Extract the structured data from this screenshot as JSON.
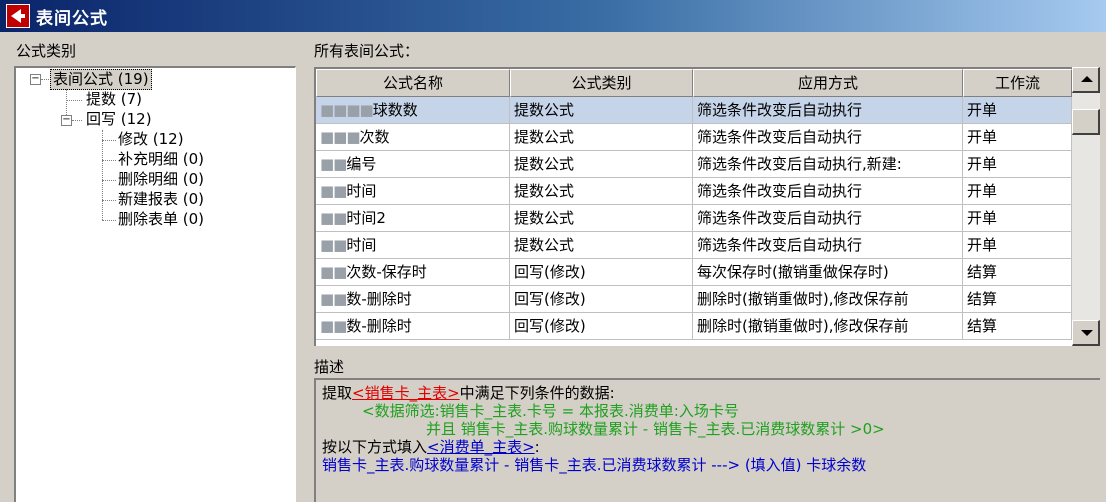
{
  "window": {
    "title": "表间公式"
  },
  "category_panel": {
    "label": "公式类别",
    "tree": {
      "root": "表间公式 (19)",
      "fetch": "提数 (7)",
      "writeback": "回写 (12)",
      "writeback_children": [
        "修改 (12)",
        "补充明细 (0)",
        "删除明细 (0)",
        "新建报表 (0)",
        "删除表单 (0)"
      ]
    }
  },
  "formula_list": {
    "label": "所有表间公式：",
    "columns": [
      "公式名称",
      "公式类别",
      "应用方式",
      "工作流"
    ],
    "rows": [
      {
        "name_hidden": "■■■■",
        "name": "球数数",
        "category": "提数公式",
        "application": "筛选条件改变后自动执行",
        "workflow": "开单"
      },
      {
        "name_hidden": "■■■",
        "name": "次数",
        "category": "提数公式",
        "application": "筛选条件改变后自动执行",
        "workflow": "开单"
      },
      {
        "name_hidden": "■■",
        "name": "编号",
        "category": "提数公式",
        "application": "筛选条件改变后自动执行,新建:",
        "workflow": "开单"
      },
      {
        "name_hidden": "■■",
        "name": "时间",
        "category": "提数公式",
        "application": "筛选条件改变后自动执行",
        "workflow": "开单"
      },
      {
        "name_hidden": "■■",
        "name": "时间2",
        "category": "提数公式",
        "application": "筛选条件改变后自动执行",
        "workflow": "开单"
      },
      {
        "name_hidden": "■■",
        "name": "时间",
        "category": "提数公式",
        "application": "筛选条件改变后自动执行",
        "workflow": "开单"
      },
      {
        "name_hidden": "■■",
        "name": "次数-保存时",
        "category": "回写(修改)",
        "application": "每次保存时(撤销重做保存时)",
        "workflow": "结算"
      },
      {
        "name_hidden": "■■",
        "name": "数-删除时",
        "category": "回写(修改)",
        "application": "删除时(撤销重做时),修改保存前",
        "workflow": "结算"
      },
      {
        "name_hidden": "■■",
        "name": "数-删除时",
        "category": "回写(修改)",
        "application": "删除时(撤销重做时),修改保存前",
        "workflow": "结算"
      }
    ]
  },
  "description": {
    "label": "描述",
    "line1_a": "提取",
    "line1_b": "<销售卡_主表>",
    "line1_c": "中满足下列条件的数据:",
    "line2": "<数据筛选:销售卡_主表.卡号 = 本报表.消费单:入场卡号",
    "line3": "并且 销售卡_主表.购球数量累计 - 销售卡_主表.已消费球数累计 >0>",
    "line4_a": "按以下方式填入",
    "line4_b": "<消费单_主表>",
    "line4_c": ":",
    "line5": "销售卡_主表.购球数量累计 - 销售卡_主表.已消费球数累计 ---> (填入值) 卡球余数"
  }
}
